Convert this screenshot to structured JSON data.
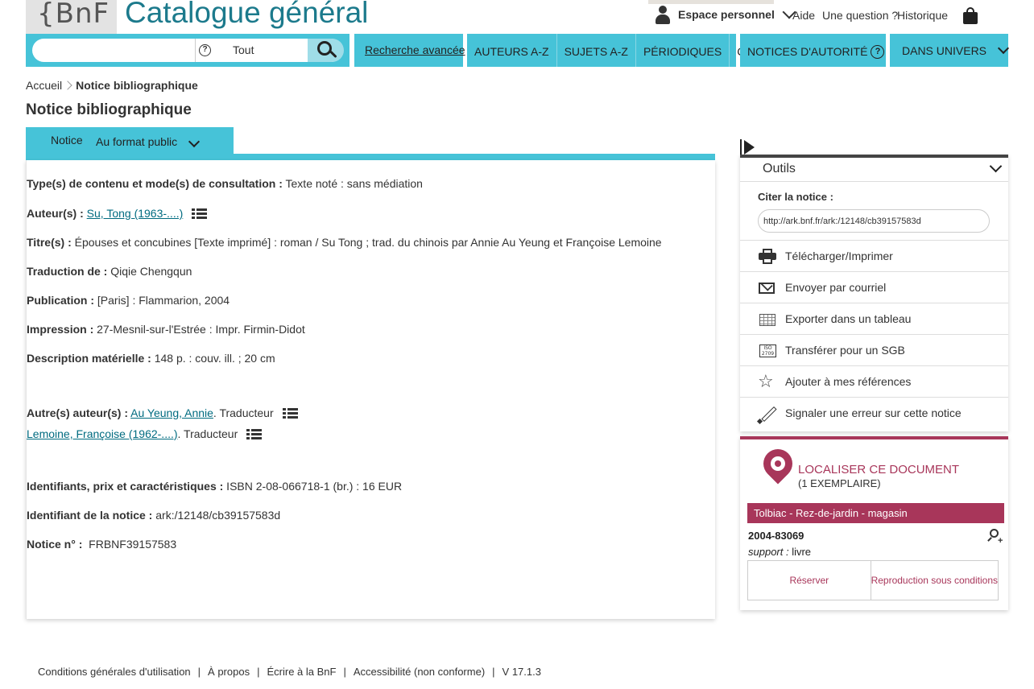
{
  "header": {
    "logo_text": "{BnF",
    "site_title": "Catalogue général",
    "espace_label": "Espace personnel",
    "links": [
      "Aide",
      "Une question ?",
      "Historique"
    ]
  },
  "nav": {
    "search_placeholder": "",
    "scope_value": "Tout",
    "advanced_label": "Recherche avancée",
    "menu": [
      "AUTEURS A-Z",
      "SUJETS A-Z",
      "PÉRIODIQUES",
      "COTE"
    ],
    "autorite_label": "NOTICES D'AUTORITÉ",
    "univers_label": "DANS UNIVERS"
  },
  "breadcrumb": {
    "home": "Accueil",
    "current": "Notice bibliographique"
  },
  "page_title": "Notice bibliographique",
  "notice": {
    "tab_label": "Notice",
    "format_value": "Au format public",
    "fields": [
      {
        "label": "Type(s) de contenu et mode(s) de consultation :",
        "value": " Texte noté : sans médiation"
      },
      {
        "label": "Auteur(s) :",
        "link": "Su, Tong (1963-....)"
      },
      {
        "label": "Titre(s) :",
        "value": " Épouses et concubines [Texte imprimé] : roman / Su Tong ; trad. du chinois par Annie Au Yeung et Françoise Lemoine"
      },
      {
        "label": "Traduction de :",
        "value": " Qiqie Chengqun"
      },
      {
        "label": "Publication :",
        "value": " [Paris] : Flammarion, 2004"
      },
      {
        "label": "Impression :",
        "value": " 27-Mesnil-sur-l'Estrée : Impr. Firmin-Didot"
      },
      {
        "label": "Description matérielle :",
        "value": " 148 p. : couv. ill. ; 20 cm"
      }
    ],
    "other_authors_label": "Autre(s) auteur(s) :",
    "other_authors": [
      {
        "name": "Au Yeung, Annie",
        "role": ". Traducteur"
      },
      {
        "name": "Lemoine, Françoise (1962-....)",
        "role": ". Traducteur"
      }
    ],
    "identifiants_label": "Identifiants, prix et caractéristiques :",
    "identifiants_value": " ISBN 2-08-066718-1 (br.) : 16 EUR",
    "ark_label": "Identifiant de la notice  :",
    "ark_value": " ark:/12148/cb39157583d",
    "num_label": "Notice n° :",
    "num_value": "  FRBNF39157583"
  },
  "outils": {
    "title": "Outils",
    "cite_label": "Citer la notice :",
    "cite_value": "http://ark.bnf.fr/ark:/12148/cb39157583d",
    "actions": [
      {
        "label": "Télécharger/Imprimer",
        "icon": "printer-icon"
      },
      {
        "label": "Envoyer par courriel",
        "icon": "mail-icon"
      },
      {
        "label": "Exporter dans un tableau",
        "icon": "table-icon"
      },
      {
        "label": "Transférer pour un SGB",
        "icon": "iso-icon"
      },
      {
        "label": "Ajouter à mes références",
        "icon": "star-icon"
      },
      {
        "label": "Signaler une erreur sur cette notice",
        "icon": "pencil-icon"
      }
    ],
    "iso_lines": [
      "ISO",
      "2709"
    ],
    "star_glyph": "☆"
  },
  "localiser": {
    "title": "LOCALISER CE DOCUMENT",
    "count": "(1 EXEMPLAIRE)",
    "place": "Tolbiac - Rez-de-jardin - magasin",
    "cote": "2004-83069",
    "support_label": "support :",
    "support_value": " livre",
    "reserve_label": "Réserver",
    "repro_label": "Reproduction sous conditions",
    "accent_color": "#a8365a"
  },
  "footer": {
    "links": [
      "Conditions générales d'utilisation",
      "À propos",
      "Écrire à la BnF",
      "Accessibilité (non conforme)",
      "V 17.1.3"
    ]
  },
  "colors": {
    "nav_teal": "#46c3d8",
    "link": "#006b80"
  }
}
